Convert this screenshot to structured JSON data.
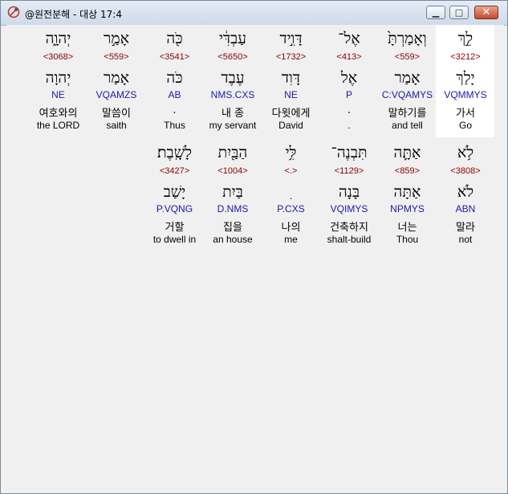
{
  "window": {
    "title": "@원전분해 - 대상 17:4"
  },
  "lines": [
    [
      {
        "surface": "לֵ֣ךְ",
        "strong": "<3212>",
        "lemma": "יָלַךְ",
        "morph": "VQMMYS",
        "korean": "가서",
        "english": "Go"
      },
      {
        "surface": "וְאָמַרְתָּ֙",
        "strong": "<559>",
        "lemma": "אָמַר",
        "morph": "C:VQAMYS",
        "korean": "말하기를",
        "english": "and tell"
      },
      {
        "surface": "אֶל־",
        "strong": "<413>",
        "lemma": "אֶל",
        "morph": "P",
        "korean": ".",
        "english": "."
      },
      {
        "surface": "דָּוִ֣יד",
        "strong": "<1732>",
        "lemma": "דָּוִד",
        "morph": "NE",
        "korean": "다윗에게",
        "english": "David"
      },
      {
        "surface": "עַבְדִּ֔י",
        "strong": "<5650>",
        "lemma": "עֶבֶד",
        "morph": "NMS.CXS",
        "korean": "내 종",
        "english": "my servant"
      },
      {
        "surface": "כֹּ֖ה",
        "strong": "<3541>",
        "lemma": "כֹּה",
        "morph": "AB",
        "korean": ".",
        "english": "Thus"
      },
      {
        "surface": "אָמַ֣ר",
        "strong": "<559>",
        "lemma": "אָמַר",
        "morph": "VQAMZS",
        "korean": "말씀이",
        "english": "saith"
      },
      {
        "surface": "יְהוָ֑ה",
        "strong": "<3068>",
        "lemma": "יְהוָה",
        "morph": "NE",
        "korean": "여호와의",
        "english": "the LORD"
      }
    ],
    [
      {
        "surface": "לֹ֥א",
        "strong": "<3808>",
        "lemma": "לֹא",
        "morph": "ABN",
        "korean": "말라",
        "english": "not"
      },
      {
        "surface": "אַתָּ֛ה",
        "strong": "<859>",
        "lemma": "אַתָּה",
        "morph": "NPMYS",
        "korean": "너는",
        "english": "Thou"
      },
      {
        "surface": "תִּבְנֶה־",
        "strong": "<1129>",
        "lemma": "בָּנָה",
        "morph": "VQIMYS",
        "korean": "건축하지",
        "english": "shalt-build"
      },
      {
        "surface": "לִּ֥י",
        "strong": "<.>",
        "lemma": "ִ",
        "morph": "P.CXS",
        "korean": "나의",
        "english": "me"
      },
      {
        "surface": "הַבַּ֖יִת",
        "strong": "<1004>",
        "lemma": "בַּיִת",
        "morph": "D.NMS",
        "korean": "집을",
        "english": "an house"
      },
      {
        "surface": "לָשָֽׁבֶת׃",
        "strong": "<3427>",
        "lemma": "יָשַׁב",
        "morph": "P.VQNG",
        "korean": "거할",
        "english": "to dwell in"
      }
    ]
  ]
}
